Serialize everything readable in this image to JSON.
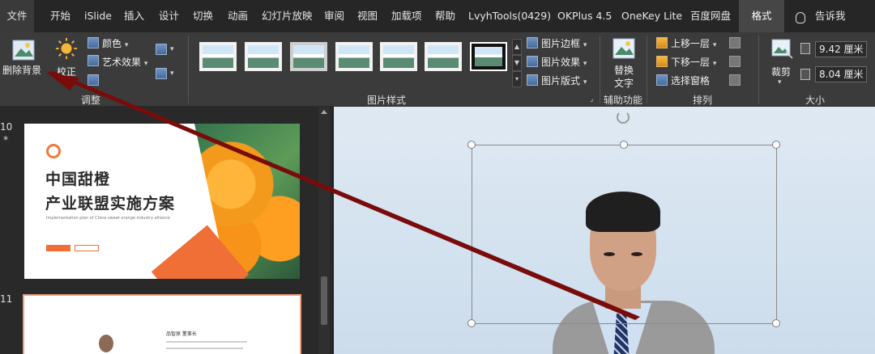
{
  "menu": {
    "items": [
      "文件",
      "开始",
      "iSlide",
      "插入",
      "设计",
      "切换",
      "动画",
      "幻灯片放映",
      "审阅",
      "视图",
      "加载项",
      "帮助",
      "LvyhTools(0429)",
      "OKPlus 4.5",
      "OneKey Lite",
      "百度网盘",
      "格式"
    ],
    "tell_me": "告诉我"
  },
  "ribbon": {
    "adjust": {
      "remove_bg": "删除背景",
      "correct": "校正",
      "color": "颜色",
      "artistic": "艺术效果",
      "label": "调整"
    },
    "styles": {
      "label": "图片样式",
      "border": "图片边框",
      "effects": "图片效果",
      "layout": "图片版式"
    },
    "accessibility": {
      "alt_text_1": "替换",
      "alt_text_2": "文字",
      "label": "辅助功能"
    },
    "arrange": {
      "bring_forward": "上移一层",
      "send_backward": "下移一层",
      "selection_pane": "选择窗格",
      "label": "排列"
    },
    "size": {
      "crop": "裁剪",
      "height": "9.42 厘米",
      "width": "8.04 厘米",
      "label": "大小"
    }
  },
  "thumbnails": {
    "slide10": {
      "number": "10",
      "star": "*",
      "title1": "中国甜橙",
      "title2": "产业联盟实施方案",
      "subtitle": "Implementation plan of China sweet orange industry alliance"
    },
    "slide11": {
      "number": "11",
      "name_text": "品智原 董事长"
    }
  },
  "colors": {
    "accent_orange": "#ef6f36",
    "ribbon_bg": "#3b3b3b",
    "arrow": "#7a0b0b"
  }
}
